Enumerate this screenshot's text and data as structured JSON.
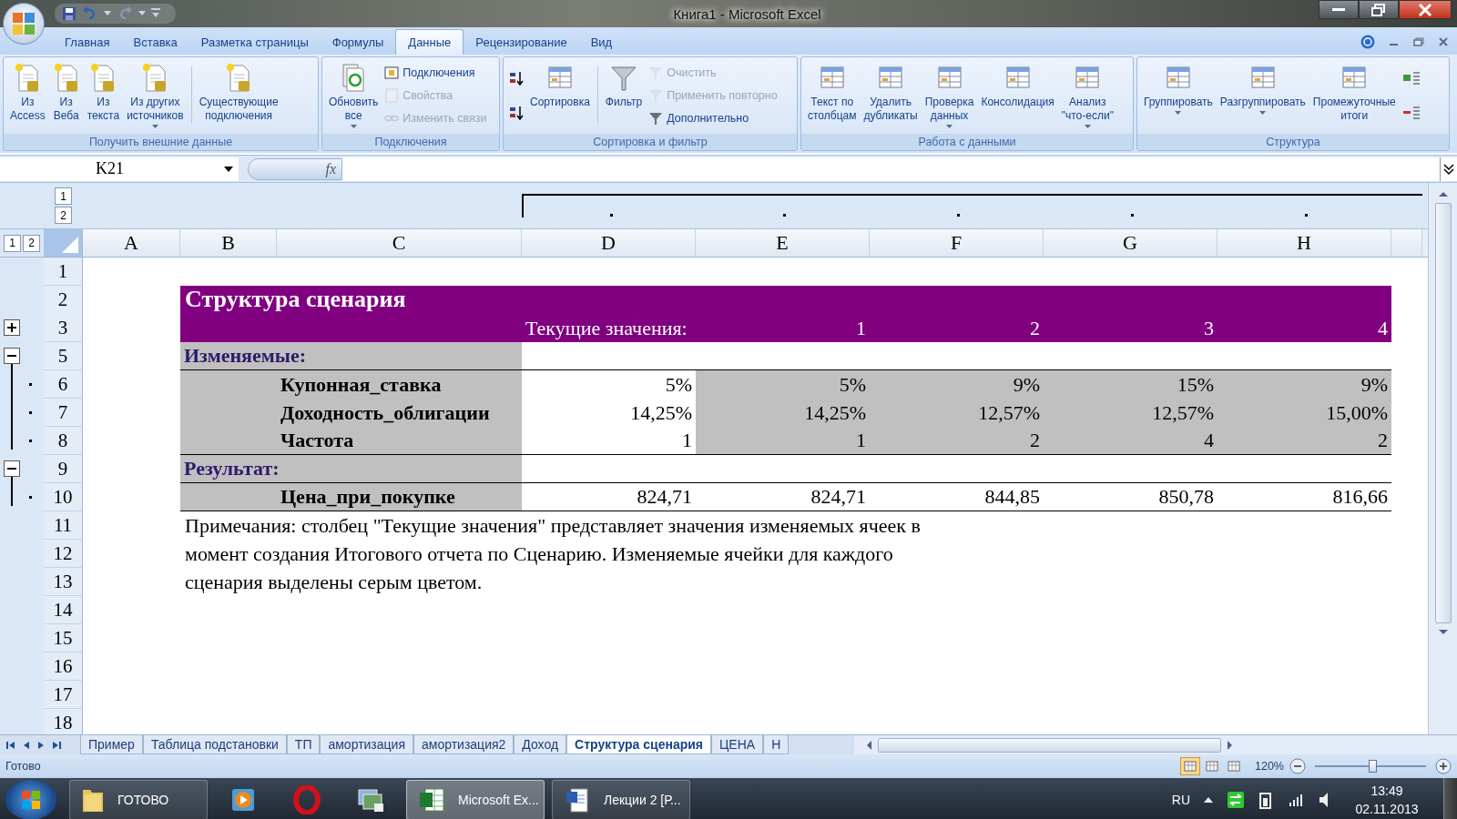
{
  "window": {
    "title": "Книга1 - Microsoft Excel"
  },
  "ribbon": {
    "tabs": [
      {
        "label": "Главная",
        "selected": false
      },
      {
        "label": "Вставка",
        "selected": false
      },
      {
        "label": "Разметка страницы",
        "selected": false
      },
      {
        "label": "Формулы",
        "selected": false
      },
      {
        "label": "Данные",
        "selected": true
      },
      {
        "label": "Рецензирование",
        "selected": false
      },
      {
        "label": "Вид",
        "selected": false
      }
    ],
    "groups": [
      {
        "label": "Получить внешние данные",
        "items": [
          {
            "kind": "large",
            "label": "Из\nAccess",
            "dropdown": false,
            "disabled": false
          },
          {
            "kind": "large",
            "label": "Из\nВеба",
            "dropdown": false,
            "disabled": false
          },
          {
            "kind": "large",
            "label": "Из\nтекста",
            "dropdown": false,
            "disabled": false
          },
          {
            "kind": "large",
            "label": "Из других\nисточников",
            "dropdown": true,
            "disabled": false
          },
          {
            "kind": "separator"
          },
          {
            "kind": "large",
            "label": "Существующие\nподключения",
            "dropdown": false,
            "disabled": false
          }
        ]
      },
      {
        "label": "Подключения",
        "items": [
          {
            "kind": "large",
            "label": "Обновить\nвсе",
            "dropdown": true,
            "disabled": false
          },
          {
            "kind": "small",
            "label": "Подключения",
            "disabled": false
          },
          {
            "kind": "small",
            "label": "Свойства",
            "disabled": true
          },
          {
            "kind": "small",
            "label": "Изменить связи",
            "disabled": true
          }
        ]
      },
      {
        "label": "Сортировка и фильтр",
        "items": [
          {
            "kind": "small",
            "disabled": false
          },
          {
            "kind": "small",
            "disabled": false
          },
          {
            "kind": "large",
            "label": "Сортировка",
            "dropdown": false,
            "disabled": false
          },
          {
            "kind": "separator"
          },
          {
            "kind": "large",
            "label": "Фильтр",
            "dropdown": false,
            "disabled": false
          },
          {
            "kind": "small",
            "label": "Очистить",
            "disabled": true
          },
          {
            "kind": "small",
            "label": "Применить повторно",
            "disabled": true
          },
          {
            "kind": "small",
            "label": "Дополнительно",
            "disabled": false
          }
        ]
      },
      {
        "label": "Работа с данными",
        "items": [
          {
            "kind": "large",
            "label": "Текст по\nстолбцам",
            "dropdown": false,
            "disabled": false
          },
          {
            "kind": "large",
            "label": "Удалить\nдубликаты",
            "dropdown": false,
            "disabled": false
          },
          {
            "kind": "large",
            "label": "Проверка\nданных",
            "dropdown": true,
            "disabled": false
          },
          {
            "kind": "large",
            "label": "Консолидация",
            "dropdown": false,
            "disabled": false
          },
          {
            "kind": "large",
            "label": "Анализ\n\"что-если\"",
            "dropdown": true,
            "disabled": false
          }
        ]
      },
      {
        "label": "Структура",
        "items": [
          {
            "kind": "large",
            "label": "Группировать",
            "dropdown": true,
            "disabled": false
          },
          {
            "kind": "large",
            "label": "Разгруппировать",
            "dropdown": true,
            "disabled": false
          },
          {
            "kind": "large",
            "label": "Промежуточные\nитоги",
            "dropdown": false,
            "disabled": false
          },
          {
            "kind": "small",
            "disabled": false
          },
          {
            "kind": "small",
            "disabled": false
          }
        ]
      }
    ]
  },
  "formula_bar": {
    "name_box": "K21",
    "function_label": "fx"
  },
  "outline": {
    "column_levels": [
      "1",
      "2"
    ],
    "row_levels": [
      "1",
      "2"
    ]
  },
  "columns": [
    {
      "label": "A",
      "grouped": false
    },
    {
      "label": "B",
      "grouped": false
    },
    {
      "label": "C",
      "grouped": false
    },
    {
      "label": "D",
      "grouped": true
    },
    {
      "label": "E",
      "grouped": true
    },
    {
      "label": "F",
      "grouped": true
    },
    {
      "label": "G",
      "grouped": true
    },
    {
      "label": "H",
      "grouped": true
    }
  ],
  "rows": [
    {
      "number": "1",
      "kind": "blank"
    },
    {
      "number": "2",
      "kind": "title",
      "text": "Структура сценария"
    },
    {
      "number": "3",
      "kind": "header",
      "current": "Текущие значения:",
      "values": [
        "1",
        "2",
        "3",
        "4"
      ],
      "expanded": false
    },
    {
      "number": "5",
      "kind": "section",
      "text": "Изменяемые:",
      "expanded": true
    },
    {
      "number": "6",
      "kind": "item",
      "label": "Купонная_ставка",
      "current": "5%",
      "values": [
        "5%",
        "9%",
        "15%",
        "9%"
      ],
      "shaded": true,
      "rule_below": false,
      "in_group": true
    },
    {
      "number": "7",
      "kind": "item",
      "label": "Доходность_облигации",
      "current": "14,25%",
      "values": [
        "14,25%",
        "12,57%",
        "12,57%",
        "15,00%"
      ],
      "shaded": true,
      "rule_below": false,
      "in_group": true
    },
    {
      "number": "8",
      "kind": "item",
      "label": "Частота",
      "current": "1",
      "values": [
        "1",
        "2",
        "4",
        "2"
      ],
      "shaded": true,
      "rule_below": true,
      "in_group": true
    },
    {
      "number": "9",
      "kind": "section",
      "text": "Результат:",
      "expanded": true
    },
    {
      "number": "10",
      "kind": "item",
      "label": "Цена_при_покупке",
      "current": "824,71",
      "values": [
        "824,71",
        "844,85",
        "850,78",
        "816,66"
      ],
      "shaded": false,
      "rule_below": true,
      "in_group": true
    },
    {
      "number": "11",
      "kind": "note",
      "text": "Примечания: столбец \"Текущие значения\" представляет значения изменяемых ячеек в"
    },
    {
      "number": "12",
      "kind": "note",
      "text": "момент создания Итогового отчета по Сценарию. Изменяемые ячейки для каждого"
    },
    {
      "number": "13",
      "kind": "note",
      "text": "сценария выделены серым цветом."
    },
    {
      "number": "14",
      "kind": "blank"
    },
    {
      "number": "15",
      "kind": "blank"
    },
    {
      "number": "16",
      "kind": "blank"
    },
    {
      "number": "17",
      "kind": "blank"
    },
    {
      "number": "18",
      "kind": "blank"
    }
  ],
  "sheet_tabs": [
    {
      "label": "Пример",
      "selected": false
    },
    {
      "label": "Таблица подстановки",
      "selected": false
    },
    {
      "label": "ТП",
      "selected": false
    },
    {
      "label": "амортизация",
      "selected": false
    },
    {
      "label": "амортизация2",
      "selected": false
    },
    {
      "label": "Доход",
      "selected": false
    },
    {
      "label": "Структура сценария",
      "selected": true
    },
    {
      "label": "ЦЕНА",
      "selected": false
    },
    {
      "label": "Н",
      "selected": false
    }
  ],
  "status_bar": {
    "text": "Готово",
    "views": [
      {
        "selected": true
      },
      {
        "selected": false
      },
      {
        "selected": false
      }
    ],
    "zoom": "120%",
    "zoom_slider": {
      "level": 0.52
    }
  },
  "taskbar": {
    "items": [
      {
        "label": "ГОТОВО",
        "selected": false
      },
      {
        "selected": false
      },
      {
        "selected": false
      },
      {
        "selected": false
      },
      {
        "label": "Microsoft Ex...",
        "selected": true
      },
      {
        "label": "Лекции 2 [Р...",
        "selected": false
      }
    ],
    "language": "RU",
    "time": "13:49",
    "date": "02.11.2013"
  }
}
